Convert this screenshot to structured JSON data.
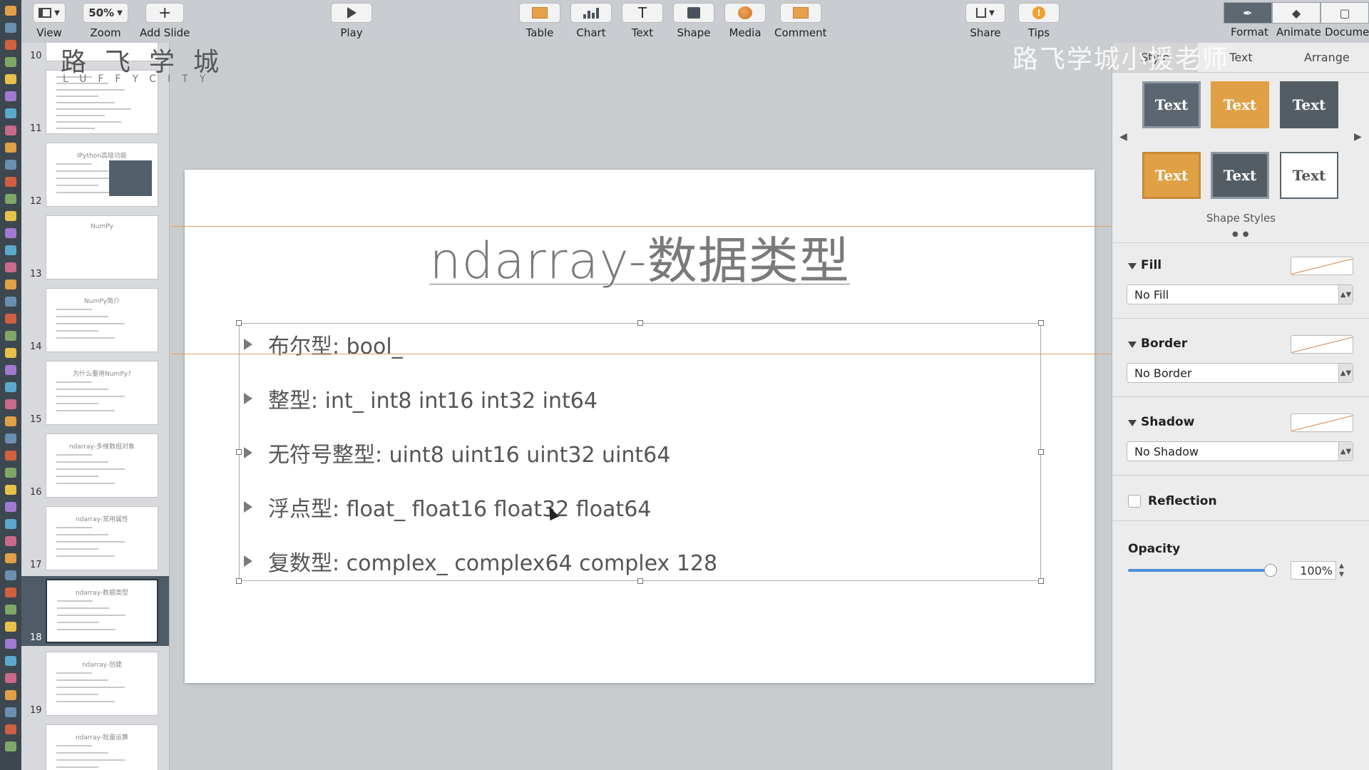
{
  "toolbar": {
    "view": "View",
    "zoom_value": "50%",
    "zoom": "Zoom",
    "add_slide": "Add Slide",
    "play": "Play",
    "table": "Table",
    "chart": "Chart",
    "text": "Text",
    "shape": "Shape",
    "media": "Media",
    "comment": "Comment",
    "share": "Share",
    "tips": "Tips",
    "tips_glyph": "!",
    "format": "Format",
    "animate": "Animate",
    "document": "Document"
  },
  "sidebar": {
    "slides": [
      {
        "num": "10",
        "title": ""
      },
      {
        "num": "11",
        "title": ""
      },
      {
        "num": "12",
        "title": "IPython高级功能"
      },
      {
        "num": "13",
        "title": "NumPy"
      },
      {
        "num": "14",
        "title": "NumPy简介"
      },
      {
        "num": "15",
        "title": "为什么要用NumPy?"
      },
      {
        "num": "16",
        "title": "ndarray-多维数组对象"
      },
      {
        "num": "17",
        "title": "ndarray-常用属性"
      },
      {
        "num": "18",
        "title": "ndarray-数据类型"
      },
      {
        "num": "19",
        "title": "ndarray-创建"
      },
      {
        "num": "",
        "title": "ndarray-批量运算"
      }
    ],
    "selected_index": 8
  },
  "watermark": {
    "brand_cn": "路飞学城",
    "brand_en": "LUFFYCITY",
    "overlay": "路飞学城小援老师"
  },
  "slide": {
    "title": "ndarray-数据类型",
    "bullets": [
      "布尔型:  bool_",
      "整型:  int_ int8 int16 int32 int64",
      "无符号整型:  uint8 uint16 uint32 uint64",
      "浮点型:  float_ float16 float32 float64",
      "复数型:  complex_ complex64 complex 128"
    ]
  },
  "inspector": {
    "tabs": [
      "Style",
      "Text",
      "Arrange"
    ],
    "active_tab": "Style",
    "style_swatch_label": "Text",
    "shape_styles_label": "Shape Styles",
    "fill_label": "Fill",
    "fill_value": "No Fill",
    "border_label": "Border",
    "border_value": "No Border",
    "shadow_label": "Shadow",
    "shadow_value": "No Shadow",
    "reflection_label": "Reflection",
    "opacity_label": "Opacity",
    "opacity_value": "100%",
    "opacity_level": 1.0,
    "accent": "#e0a046",
    "dark": "#53606b"
  }
}
